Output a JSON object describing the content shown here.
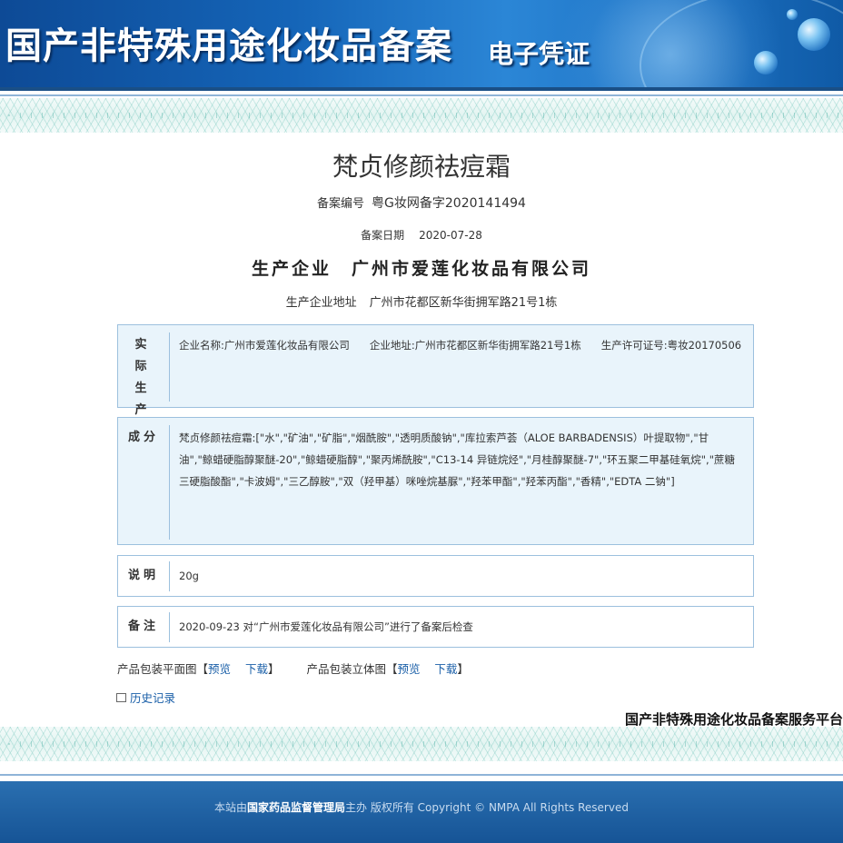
{
  "header": {
    "title": "国产非特殊用途化妆品备案",
    "subtitle": "电子凭证"
  },
  "product": {
    "name": "梵贞修颜祛痘霜",
    "record_no_label": "备案编号",
    "record_no": "粤G妆网备字2020141494",
    "date_label": "备案日期",
    "date": "2020-07-28",
    "manufacturer_label": "生产企业",
    "manufacturer": "广州市爱莲化妆品有限公司",
    "address_label": "生产企业地址",
    "address": "广州市花都区新华街拥军路21号1栋"
  },
  "actual_producer": {
    "label": "实际生产企业",
    "name_label": "企业名称:",
    "name": "广州市爱莲化妆品有限公司",
    "address_label": "企业地址:",
    "address": "广州市花都区新华街拥军路21号1栋",
    "license_label": "生产许可证号:",
    "license": "粤妆20170506"
  },
  "ingredients": {
    "label": "成分",
    "text": "梵贞修颜祛痘霜:[\"水\",\"矿油\",\"矿脂\",\"烟酰胺\",\"透明质酸钠\",\"库拉索芦荟（ALOE BARBADENSIS）叶提取物\",\"甘油\",\"鲸蜡硬脂醇聚醚-20\",\"鲸蜡硬脂醇\",\"聚丙烯酰胺\",\"C13-14 异链烷烃\",\"月桂醇聚醚-7\",\"环五聚二甲基硅氧烷\",\"蔗糖三硬脂酸酯\",\"卡波姆\",\"三乙醇胺\",\"双（羟甲基）咪唑烷基脲\",\"羟苯甲酯\",\"羟苯丙酯\",\"香精\",\"EDTA 二钠\"]"
  },
  "description": {
    "label": "说明",
    "text": "20g"
  },
  "remarks": {
    "label": "备注",
    "text": "2020-09-23 对“广州市爱莲化妆品有限公司”进行了备案后检查"
  },
  "links": {
    "flat_label": "产品包装平面图",
    "solid_label": "产品包装立体图",
    "bracket_open": "【",
    "bracket_close": "】",
    "preview": "预览",
    "download": "下载",
    "history": "历史记录"
  },
  "platform_name": "国产非特殊用途化妆品备案服务平台",
  "footer": {
    "prefix": "本站由",
    "org": "国家药品监督管理局",
    "suffix": "主办 版权所有 Copyright © NMPA All Rights Reserved"
  }
}
